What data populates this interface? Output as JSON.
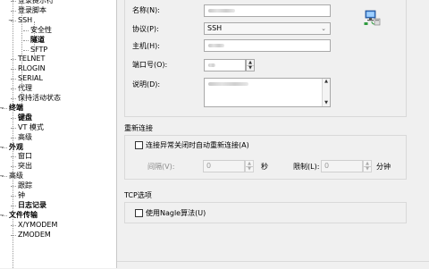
{
  "tree": {
    "items": [
      {
        "label": "登录提示符",
        "indent": 2,
        "bold": false
      },
      {
        "label": "登录脚本",
        "indent": 2,
        "bold": false
      },
      {
        "label": "SSH",
        "indent": 2,
        "bold": false,
        "toggle": "−"
      },
      {
        "label": "安全性",
        "indent": 3,
        "bold": false
      },
      {
        "label": "隧道",
        "indent": 3,
        "bold": true
      },
      {
        "label": "SFTP",
        "indent": 3,
        "bold": false
      },
      {
        "label": "TELNET",
        "indent": 2,
        "bold": false
      },
      {
        "label": "RLOGIN",
        "indent": 2,
        "bold": false
      },
      {
        "label": "SERIAL",
        "indent": 2,
        "bold": false
      },
      {
        "label": "代理",
        "indent": 2,
        "bold": false
      },
      {
        "label": "保持活动状态",
        "indent": 2,
        "bold": false
      },
      {
        "label": "终端",
        "indent": 1,
        "bold": true,
        "toggle": "−"
      },
      {
        "label": "键盘",
        "indent": 2,
        "bold": true
      },
      {
        "label": "VT 模式",
        "indent": 2,
        "bold": false
      },
      {
        "label": "高级",
        "indent": 2,
        "bold": false
      },
      {
        "label": "外观",
        "indent": 1,
        "bold": true,
        "toggle": "−"
      },
      {
        "label": "窗口",
        "indent": 2,
        "bold": false
      },
      {
        "label": "突出",
        "indent": 2,
        "bold": false
      },
      {
        "label": "高级",
        "indent": 1,
        "bold": false,
        "toggle": "−"
      },
      {
        "label": "跟踪",
        "indent": 2,
        "bold": false
      },
      {
        "label": "钟",
        "indent": 2,
        "bold": false
      },
      {
        "label": "日志记录",
        "indent": 2,
        "bold": true
      },
      {
        "label": "文件传输",
        "indent": 1,
        "bold": true,
        "toggle": "−"
      },
      {
        "label": "X/YMODEM",
        "indent": 2,
        "bold": false
      },
      {
        "label": "ZMODEM",
        "indent": 2,
        "bold": false
      }
    ]
  },
  "connection": {
    "name_label": "名称(N):",
    "protocol_label": "协议(P):",
    "protocol_value": "SSH",
    "host_label": "主机(H):",
    "port_label": "端口号(O):",
    "description_label": "说明(D):"
  },
  "reconnect": {
    "section_title": "重新连接",
    "checkbox_label": "连接异常关闭时自动重新连接(A)",
    "interval_label": "间隔(V):",
    "interval_value": "0",
    "interval_unit": "秒",
    "limit_label": "限制(L):",
    "limit_value": "0",
    "limit_unit": "分钟"
  },
  "tcp": {
    "section_title": "TCP选项",
    "nagle_label": "使用Nagle算法(U)"
  },
  "colors": {
    "panel_bg": "#f0f0f0",
    "tree_bg": "#ffffff",
    "border": "#a9a9a9",
    "disabled_text": "#8c8c8c"
  },
  "icons": {
    "session": "computer-network-icon"
  }
}
